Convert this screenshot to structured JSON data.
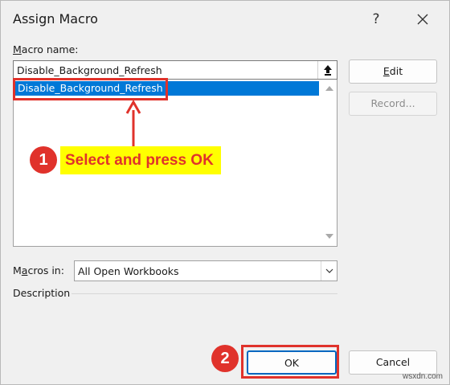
{
  "window": {
    "title": "Assign Macro",
    "help_glyph": "?"
  },
  "macro_name": {
    "label_underlined": "M",
    "label_rest": "acro name:",
    "value": "Disable_Background_Refresh"
  },
  "macro_list": {
    "items": [
      "Disable_Background_Refresh"
    ],
    "selected_index": 0
  },
  "buttons": {
    "edit_underlined": "E",
    "edit_rest": "dit",
    "record": "Record...",
    "ok": "OK",
    "cancel": "Cancel"
  },
  "macros_in": {
    "label_pre": "M",
    "label_underlined": "a",
    "label_rest": "cros in:",
    "value": "All Open Workbooks"
  },
  "description": {
    "label": "Description"
  },
  "annotations": {
    "step1_number": "1",
    "step1_text": "Select and press OK",
    "step2_number": "2",
    "highlight_color": "#e0322b",
    "callout_bg": "#ffff00"
  },
  "watermark": "wsxdn.com",
  "colors": {
    "selection": "#0078d7",
    "ok_border": "#0067c0"
  }
}
